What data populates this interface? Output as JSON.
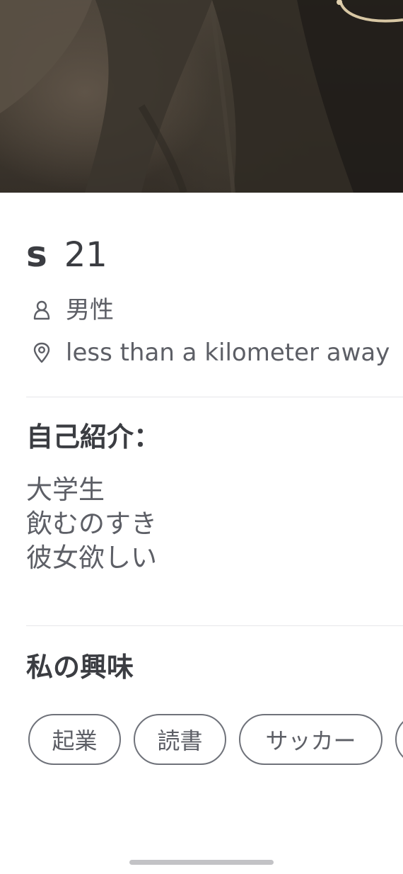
{
  "profile": {
    "name": "s",
    "age": "21",
    "gender": "男性",
    "distance": "less than a kilometer away",
    "gender_icon": "person-icon",
    "distance_icon": "location-pin-icon",
    "photo_icon": "profile-photo"
  },
  "bio": {
    "title": "自己紹介：",
    "lines": [
      "大学生",
      "飲むのすき",
      "彼女欲しい"
    ]
  },
  "interests": {
    "title": "私の興味",
    "items": [
      "起業",
      "読書",
      "サッカー",
      ""
    ]
  },
  "colors": {
    "text_primary": "#3b3d42",
    "text_secondary": "#5d5f66",
    "chip_border": "#6f727a",
    "divider": "#e6e6e9"
  }
}
